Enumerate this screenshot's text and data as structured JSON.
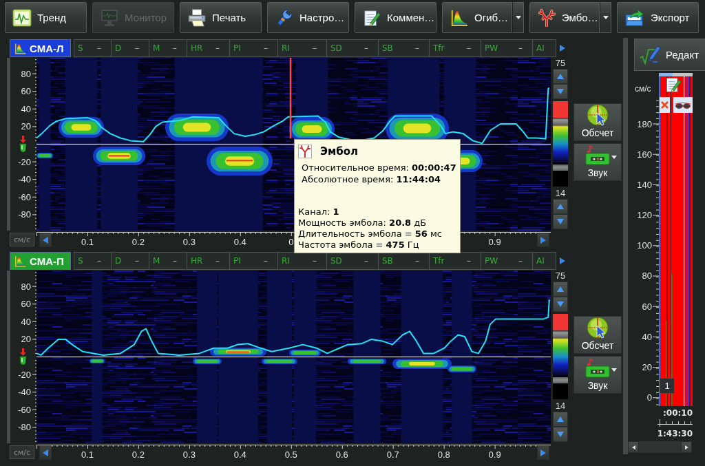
{
  "toolbar": {
    "buttons": [
      {
        "label": "Тренд",
        "disabled": false,
        "dropdown": false
      },
      {
        "label": "Монитор",
        "disabled": true,
        "dropdown": false
      },
      {
        "label": "Печать",
        "disabled": false,
        "dropdown": false
      },
      {
        "label": "Настро…",
        "disabled": false,
        "dropdown": false
      },
      {
        "label": "Коммен…",
        "disabled": false,
        "dropdown": false
      },
      {
        "label": "Огиб…",
        "disabled": false,
        "dropdown": true
      },
      {
        "label": "Эмбо…",
        "disabled": false,
        "dropdown": true
      },
      {
        "label": "Экспорт",
        "disabled": false,
        "dropdown": false
      }
    ]
  },
  "channels": [
    {
      "name": "СМА-Л",
      "color": "#1c3ed8",
      "parameters": [
        {
          "label": "S",
          "value": "–"
        },
        {
          "label": "D",
          "value": "–"
        },
        {
          "label": "M",
          "value": "–"
        },
        {
          "label": "HR",
          "value": "–"
        },
        {
          "label": "PI",
          "value": "–"
        },
        {
          "label": "RI",
          "value": "–"
        },
        {
          "label": "SD",
          "value": "–"
        },
        {
          "label": "SB",
          "value": "–"
        },
        {
          "label": "Tfr",
          "value": "–"
        },
        {
          "label": "PW",
          "value": "–"
        },
        {
          "label": "AI"
        }
      ],
      "chart_data": {
        "type": "line",
        "x": [
          0,
          0.012,
          0.026,
          0.039,
          0.057,
          0.101,
          0.115,
          0.128,
          0.145,
          0.165,
          0.185,
          0.21,
          0.223,
          0.234,
          0.247,
          0.283,
          0.307,
          0.358,
          0.372,
          0.388,
          0.41,
          0.429,
          0.446,
          0.466,
          0.483,
          0.494,
          0.553,
          0.567,
          0.577,
          0.594,
          0.618,
          0.645,
          0.663,
          0.68,
          0.694,
          0.704,
          0.776,
          0.794,
          0.803,
          0.817,
          0.838,
          0.857,
          0.875,
          0.892,
          0.911,
          0.942,
          0.956,
          0.965,
          0.983,
          1.0,
          1.005,
          1.007
        ],
        "series": [
          {
            "color": "#22e4f4",
            "values": [
              7,
              13,
              21,
              26,
              29,
              30,
              27,
              19,
              12,
              7,
              4,
              3,
              11,
              20,
              25,
              27,
              31,
              30,
              21,
              12,
              9,
              11,
              14,
              21,
              26,
              31,
              32,
              25,
              14,
              8,
              5,
              5,
              7,
              15,
              26,
              32,
              32,
              21,
              12,
              14,
              12,
              4,
              1,
              16,
              23,
              23,
              14,
              7,
              7,
              6,
              63,
              64
            ]
          }
        ],
        "xlim": [
          0,
          1.01
        ],
        "ylim": [
          -98,
          98
        ],
        "xticks": [
          0.1,
          0.2,
          0.3,
          0.4,
          {
            "value": 0.5,
            "label": "0"
          },
          0.9
        ],
        "yticks": [
          80,
          60,
          40,
          20,
          -20,
          -40,
          -60,
          -80
        ],
        "ref_lines": [
          {
            "axis": "x",
            "value": 0.499
          }
        ]
      },
      "scale": {
        "max": "75",
        "min": "14"
      },
      "actions": [
        {
          "label": "Обсчет",
          "dropdown": false
        },
        {
          "label": "Звук",
          "dropdown": true
        }
      ],
      "unit": "см/с"
    },
    {
      "name": "СМА-П",
      "color": "#22a032",
      "parameters": [
        {
          "label": "S",
          "value": "–"
        },
        {
          "label": "D",
          "value": "–"
        },
        {
          "label": "M",
          "value": "–"
        },
        {
          "label": "HR",
          "value": "–"
        },
        {
          "label": "PI",
          "value": "–"
        },
        {
          "label": "RI",
          "value": "–"
        },
        {
          "label": "SD",
          "value": "–"
        },
        {
          "label": "SB",
          "value": "–"
        },
        {
          "label": "Tfr",
          "value": "–"
        },
        {
          "label": "PW",
          "value": "–"
        },
        {
          "label": "AI"
        }
      ],
      "chart_data": {
        "type": "line",
        "x": [
          0,
          0.009,
          0.023,
          0.043,
          0.057,
          0.07,
          0.091,
          0.131,
          0.165,
          0.192,
          0.206,
          0.215,
          0.226,
          0.239,
          0.28,
          0.32,
          0.348,
          0.375,
          0.395,
          0.415,
          0.435,
          0.462,
          0.496,
          0.523,
          0.55,
          0.571,
          0.591,
          0.611,
          0.638,
          0.658,
          0.679,
          0.699,
          0.719,
          0.733,
          0.746,
          0.76,
          0.78,
          0.801,
          0.814,
          0.828,
          0.841,
          0.855,
          0.868,
          0.882,
          0.891,
          0.902,
          0.996,
          1.005,
          1.007
        ],
        "series": [
          {
            "color": "#22e4f4",
            "values": [
              4,
              2,
              10,
              20,
              20,
              14,
              6,
              2,
              4,
              14,
              29,
              32,
              18,
              4,
              2,
              4,
              10,
              10,
              14,
              15,
              11,
              6,
              10,
              14,
              10,
              4,
              9,
              14,
              15,
              20,
              18,
              14,
              25,
              29,
              18,
              4,
              4,
              10,
              18,
              25,
              23,
              6,
              4,
              18,
              37,
              43,
              43,
              45,
              65
            ]
          }
        ],
        "xlim": [
          0,
          1.01
        ],
        "ylim": [
          -98,
          98
        ],
        "xticks": [
          0.1,
          0.2,
          0.3,
          0.4,
          0.5,
          0.6,
          0.7,
          0.8,
          0.9
        ],
        "yticks": [
          80,
          60,
          40,
          20,
          -20,
          -40,
          -60,
          -80
        ]
      },
      "scale": {
        "max": "75",
        "min": "14"
      },
      "actions": [
        {
          "label": "Обсчет",
          "dropdown": false
        },
        {
          "label": "Звук",
          "dropdown": true
        }
      ],
      "unit": "см/с"
    }
  ],
  "tooltip": {
    "title": "Эмбол",
    "times": [
      "Относительное время: **00:00:47**",
      "Абсолютное время: **11:44:04**"
    ],
    "details": [
      "Канал: **1**",
      "Мощность эмбола: **20.8** дБ",
      "Длительность эмбола = **56** мс",
      "Частота эмбола = **475** Гц"
    ]
  },
  "trend": {
    "button": {
      "label": "Редакт"
    },
    "unit": "см/с",
    "y_axis": {
      "ticks": [
        "180",
        "160",
        "140",
        "120",
        "100",
        "80",
        "60",
        "40",
        "20",
        "0"
      ]
    },
    "marker": "1",
    "time_offset": ":00:10",
    "clock_time": "1:43:30"
  }
}
